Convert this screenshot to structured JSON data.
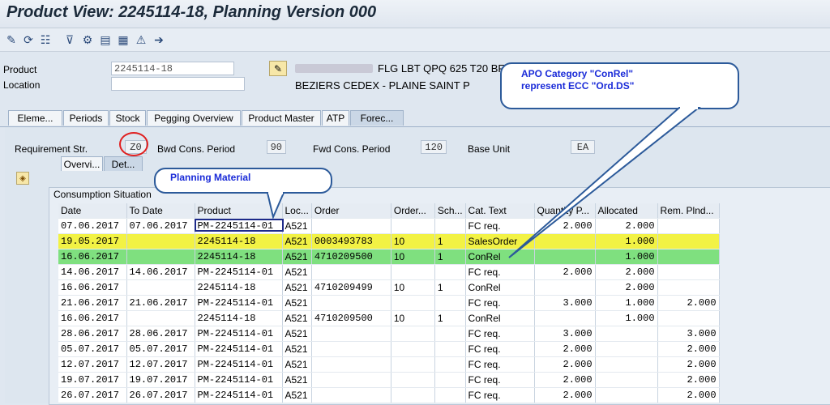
{
  "title": "Product View: 2245114-18, Planning Version 000",
  "toolbar_icons": [
    "pencil-icon",
    "refresh-icon",
    "hierarchy-icon",
    "filter-icon",
    "settings-icon",
    "print-icon",
    "export-icon",
    "alert-icon",
    "forward-icon"
  ],
  "header": {
    "product_label": "Product",
    "product_value": "2245114-18",
    "location_label": "Location",
    "location_value": "",
    "product_desc": "FLG LBT QPQ 625 T20 BF",
    "location_desc": "BEZIERS CEDEX - PLAINE SAINT P"
  },
  "tabs": [
    "Eleme...",
    "Periods",
    "Stock",
    "Pegging Overview",
    "Product Master",
    "ATP",
    "Forec..."
  ],
  "forecast": {
    "req_label": "Requirement Str.",
    "req_value": "Z0",
    "bwd_label": "Bwd Cons. Period",
    "bwd_value": "90",
    "fwd_label": "Fwd Cons. Period",
    "fwd_value": "120",
    "unit_label": "Base Unit",
    "unit_value": "EA"
  },
  "subtabs": [
    "Overvi...",
    "Det..."
  ],
  "table": {
    "title": "Consumption Situation",
    "columns": [
      "Date",
      "To Date",
      "Product",
      "Loc...",
      "Order",
      "Order...",
      "Sch...",
      "Cat. Text",
      "Quantity P...",
      "Allocated",
      "Rem. Plnd..."
    ],
    "rows": [
      [
        "07.06.2017",
        "07.06.2017",
        "PM-2245114-01",
        "A521",
        "",
        "",
        "",
        "FC req.",
        "2.000",
        "2.000",
        ""
      ],
      [
        "19.05.2017",
        "",
        "2245114-18",
        "A521",
        "0003493783",
        "10",
        "1",
        "SalesOrder",
        "",
        "1.000",
        ""
      ],
      [
        "16.06.2017",
        "",
        "2245114-18",
        "A521",
        "4710209500",
        "10",
        "1",
        "ConRel",
        "",
        "1.000",
        ""
      ],
      [
        "14.06.2017",
        "14.06.2017",
        "PM-2245114-01",
        "A521",
        "",
        "",
        "",
        "FC req.",
        "2.000",
        "2.000",
        ""
      ],
      [
        "16.06.2017",
        "",
        "2245114-18",
        "A521",
        "4710209499",
        "10",
        "1",
        "ConRel",
        "",
        "2.000",
        ""
      ],
      [
        "21.06.2017",
        "21.06.2017",
        "PM-2245114-01",
        "A521",
        "",
        "",
        "",
        "FC req.",
        "3.000",
        "1.000",
        "2.000"
      ],
      [
        "16.06.2017",
        "",
        "2245114-18",
        "A521",
        "4710209500",
        "10",
        "1",
        "ConRel",
        "",
        "1.000",
        ""
      ],
      [
        "28.06.2017",
        "28.06.2017",
        "PM-2245114-01",
        "A521",
        "",
        "",
        "",
        "FC req.",
        "3.000",
        "",
        "3.000"
      ],
      [
        "05.07.2017",
        "05.07.2017",
        "PM-2245114-01",
        "A521",
        "",
        "",
        "",
        "FC req.",
        "2.000",
        "",
        "2.000"
      ],
      [
        "12.07.2017",
        "12.07.2017",
        "PM-2245114-01",
        "A521",
        "",
        "",
        "",
        "FC req.",
        "2.000",
        "",
        "2.000"
      ],
      [
        "19.07.2017",
        "19.07.2017",
        "PM-2245114-01",
        "A521",
        "",
        "",
        "",
        "FC req.",
        "2.000",
        "",
        "2.000"
      ],
      [
        "26.07.2017",
        "26.07.2017",
        "PM-2245114-01",
        "A521",
        "",
        "",
        "",
        "FC req.",
        "2.000",
        "",
        "2.000"
      ]
    ]
  },
  "callouts": {
    "planning_material": "Planning Material",
    "apo_line1": "APO Category \"ConRel\"",
    "apo_line2": "represent ECC \"Ord.DS\""
  },
  "colors": {
    "highlight_yellow": "#f2f244",
    "highlight_green": "#7fe07f",
    "callout_text": "#1a2bd8",
    "annotation_red": "#e02020"
  }
}
